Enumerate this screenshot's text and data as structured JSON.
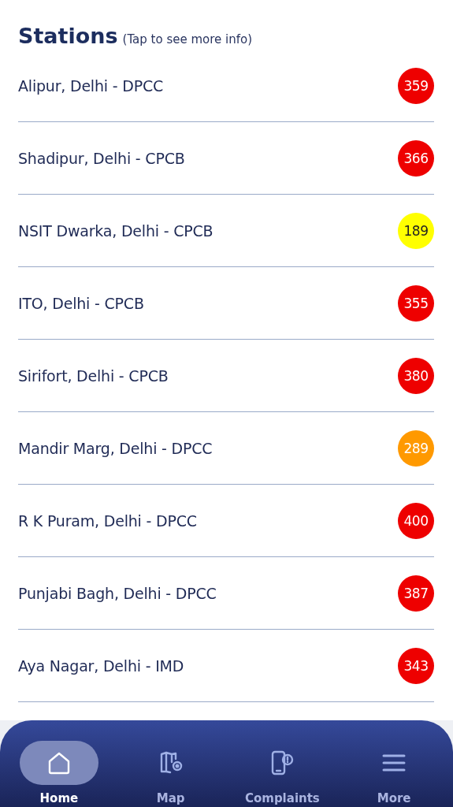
{
  "header": {
    "title": "Stations",
    "hint": "(Tap to see more info)"
  },
  "stations": [
    {
      "name": "Alipur, Delhi - DPCC",
      "aqi": "359",
      "color": "#ee0000"
    },
    {
      "name": "Shadipur, Delhi - CPCB",
      "aqi": "366",
      "color": "#ee0000"
    },
    {
      "name": "NSIT Dwarka, Delhi - CPCB",
      "aqi": "189",
      "color": "#ffff00"
    },
    {
      "name": "ITO, Delhi - CPCB",
      "aqi": "355",
      "color": "#ee0000"
    },
    {
      "name": "Sirifort, Delhi - CPCB",
      "aqi": "380",
      "color": "#ee0000"
    },
    {
      "name": "Mandir Marg, Delhi - DPCC",
      "aqi": "289",
      "color": "#ff9900"
    },
    {
      "name": "R K Puram, Delhi - DPCC",
      "aqi": "400",
      "color": "#ee0000"
    },
    {
      "name": "Punjabi Bagh, Delhi - DPCC",
      "aqi": "387",
      "color": "#ee0000"
    },
    {
      "name": "Aya Nagar, Delhi - IMD",
      "aqi": "343",
      "color": "#ee0000"
    }
  ],
  "nav": [
    {
      "kind": "home",
      "label": "Home",
      "selected": true
    },
    {
      "kind": "map",
      "label": "Map",
      "selected": false
    },
    {
      "kind": "complaints",
      "label": "Complaints",
      "selected": false
    },
    {
      "kind": "more",
      "label": "More",
      "selected": false
    }
  ]
}
